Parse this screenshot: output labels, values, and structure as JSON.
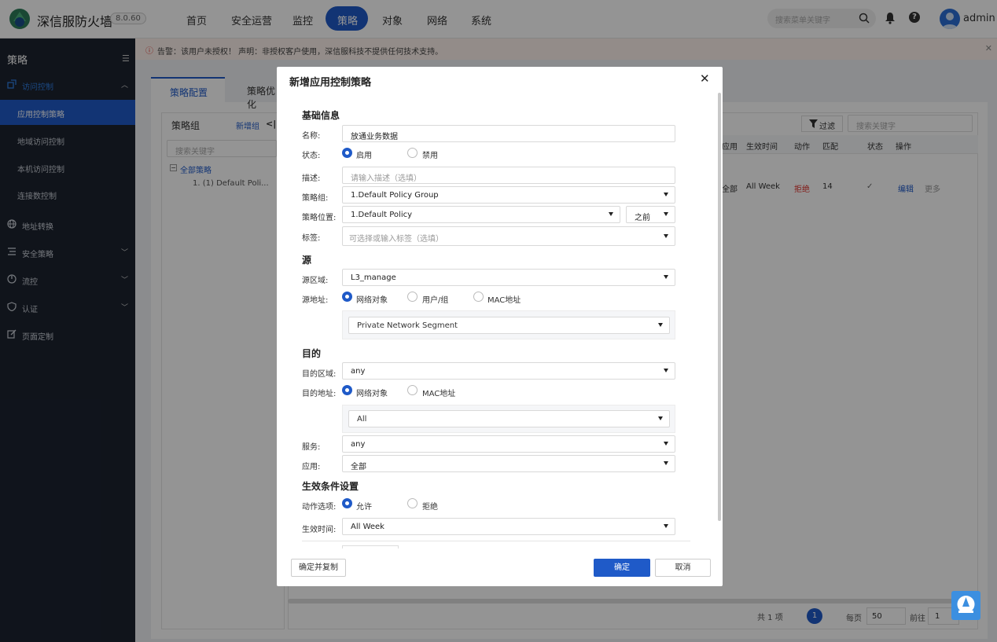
{
  "header": {
    "brand": "深信服防火墙",
    "version": "8.0.60",
    "nav": [
      "首页",
      "安全运营",
      "监控",
      "策略",
      "对象",
      "网络",
      "系统"
    ],
    "active_nav": "策略",
    "search_placeholder": "搜索菜单关键字",
    "user": "admin"
  },
  "sidebar": {
    "title": "策略",
    "groups": [
      {
        "label": "访问控制",
        "icon": "access-control-icon",
        "expanded": true
      },
      {
        "label": "地址转换",
        "icon": "globe-icon"
      },
      {
        "label": "安全策略",
        "icon": "list-icon"
      },
      {
        "label": "流控",
        "icon": "flow-icon"
      },
      {
        "label": "认证",
        "icon": "shield-icon"
      },
      {
        "label": "页面定制",
        "icon": "edit-icon"
      }
    ],
    "sub_items": [
      "应用控制策略",
      "地域访问控制",
      "本机访问控制",
      "连接数控制"
    ],
    "active_sub": "应用控制策略"
  },
  "alert": {
    "text": "告警：该用户未授权！   声明：非授权客户使用，深信服科技不提供任何技术支持。"
  },
  "page": {
    "tabs": [
      "策略配置",
      "策略优化"
    ],
    "group_panel": {
      "title": "策略组",
      "add_label": "新增组",
      "search_placeholder": "搜索关键字",
      "tree_root": "全部策略",
      "tree_child": "1. (1)  Default Poli..."
    },
    "rule_panel": {
      "filter_label": "过滤",
      "search_placeholder": "搜索关键字",
      "columns": [
        "应用",
        "生效时间",
        "动作",
        "匹配",
        "状态",
        "操作"
      ],
      "row": {
        "app": "全部",
        "time": "All Week",
        "action": "拒绝",
        "match": "14",
        "edit": "编辑",
        "more": "更多"
      }
    },
    "pager": {
      "total": "共 1 项",
      "current_page": "1",
      "per_page_label": "每页",
      "per_page": "50",
      "goto_label": "前往",
      "goto_value": "1"
    }
  },
  "modal": {
    "title": "新增应用控制策略",
    "sections": {
      "basic": "基础信息",
      "source": "源",
      "dest": "目的",
      "effect": "生效条件设置"
    },
    "fields": {
      "name_label": "名称:",
      "name_value": "放通业务数据",
      "status_label": "状态:",
      "status_on": "启用",
      "status_off": "禁用",
      "desc_label": "描述:",
      "desc_placeholder": "请输入描述（选填）",
      "group_label": "策略组:",
      "group_value": "1.Default Policy Group",
      "position_label": "策略位置:",
      "position_value": "1.Default Policy",
      "position_order": "之前",
      "tag_label": "标签:",
      "tag_placeholder": "可选择或输入标签（选填）",
      "src_zone_label": "源区域:",
      "src_zone_value": "L3_manage",
      "src_addr_label": "源地址:",
      "src_opt1": "网络对象",
      "src_opt2": "用户/组",
      "src_opt3": "MAC地址",
      "src_addr_value": "Private Network Segment",
      "dst_zone_label": "目的区域:",
      "dst_zone_value": "any",
      "dst_addr_label": "目的地址:",
      "dst_opt1": "网络对象",
      "dst_opt2": "MAC地址",
      "dst_addr_value": "All",
      "service_label": "服务:",
      "service_value": "any",
      "app_label": "应用:",
      "app_value": "全部",
      "action_label": "动作选项:",
      "action_allow": "允许",
      "action_deny": "拒绝",
      "time_label": "生效时间:",
      "time_value": "All Week"
    },
    "buttons": {
      "copy": "确定并复制",
      "ok": "确定",
      "cancel": "取消"
    }
  },
  "colors": {
    "primary": "#1f5ac8",
    "sidebar_bg": "#1c2330",
    "deny_red": "#e0312b"
  }
}
